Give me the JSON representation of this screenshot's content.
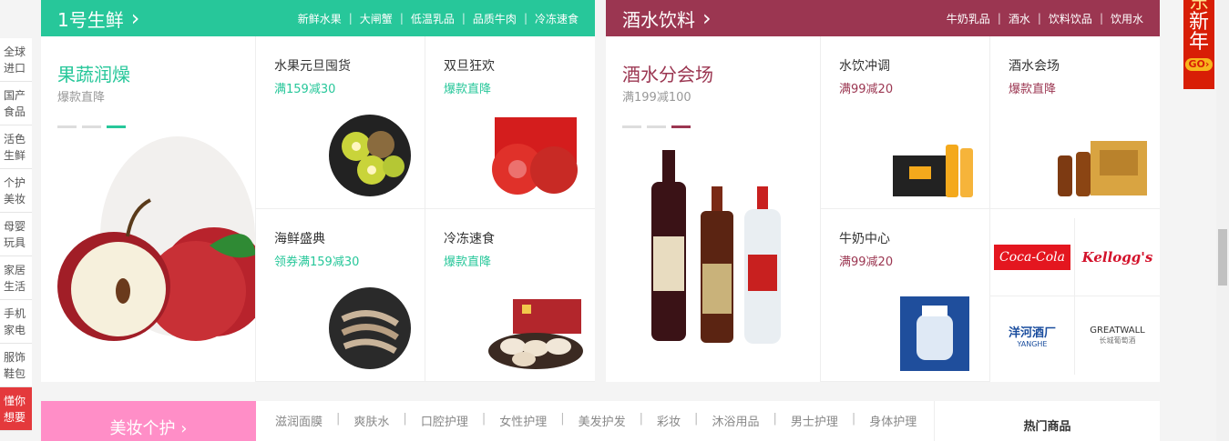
{
  "sidenav": [
    {
      "line1": "全球",
      "line2": "进口"
    },
    {
      "line1": "国产",
      "line2": "食品"
    },
    {
      "line1": "活色",
      "line2": "生鲜"
    },
    {
      "line1": "个护",
      "line2": "美妆"
    },
    {
      "line1": "母婴",
      "line2": "玩具"
    },
    {
      "line1": "家居",
      "line2": "生活"
    },
    {
      "line1": "手机",
      "line2": "家电"
    },
    {
      "line1": "服饰",
      "line2": "鞋包"
    },
    {
      "line1": "懂你",
      "line2": "想要"
    }
  ],
  "floor1": {
    "title": "1号生鲜",
    "arrow": "›",
    "links": [
      "新鲜水果",
      "大闸蟹",
      "低温乳品",
      "品质牛肉",
      "冷冻速食"
    ],
    "feature": {
      "name": "果蔬润燥",
      "sub": "爆款直降"
    },
    "cells": [
      {
        "name": "水果元旦囤货",
        "desc": "满159减30"
      },
      {
        "name": "双旦狂欢",
        "desc": "爆款直降"
      },
      {
        "name": "海鲜盛典",
        "desc": "领券满159减30"
      },
      {
        "name": "冷冻速食",
        "desc": "爆款直降"
      }
    ]
  },
  "floor2": {
    "title": "酒水饮料",
    "arrow": "›",
    "links": [
      "牛奶乳品",
      "酒水",
      "饮料饮品",
      "饮用水"
    ],
    "feature": {
      "name": "酒水分会场",
      "sub": "满199减100"
    },
    "cells": [
      {
        "name": "水饮冲调",
        "desc": "满99减20"
      },
      {
        "name": "酒水会场",
        "desc": "爆款直降"
      },
      {
        "name": "牛奶中心",
        "desc": "满99减20"
      }
    ],
    "brands": {
      "b1": "Coca-Cola",
      "b2": "Kellogg's",
      "b3_cn": "洋河酒厂",
      "b3_en": "YANGHE",
      "b4_en": "GREATWALL",
      "b4_cn": "长城葡萄酒"
    }
  },
  "floor3": {
    "title": "美妆个护 ›",
    "cats": [
      "滋润面膜",
      "爽肤水",
      "口腔护理",
      "女性护理",
      "美发护发",
      "彩妆",
      "沐浴用品",
      "男士护理",
      "身体护理"
    ],
    "hot": "热门商品"
  },
  "newyear": {
    "top": "东",
    "mid1": "新",
    "mid2": "年",
    "go": "GO›"
  },
  "colors": {
    "fresh": "#27c79a",
    "wine": "#9b3651",
    "beauty": "#ff8ec7",
    "active_nav": "#e4393c"
  }
}
